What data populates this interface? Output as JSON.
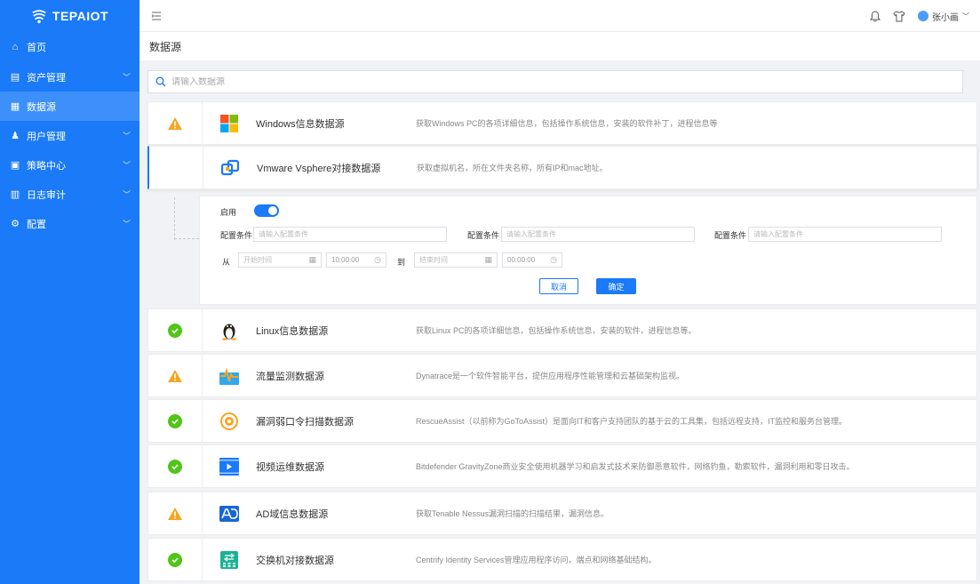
{
  "brand": {
    "name": "TEPAIOT"
  },
  "sidebar": {
    "items": [
      {
        "label": "首页",
        "icon": "home-icon",
        "has_children": false,
        "active": false
      },
      {
        "label": "资产管理",
        "icon": "asset-icon",
        "has_children": true,
        "active": false
      },
      {
        "label": "数据源",
        "icon": "datasource-icon",
        "has_children": false,
        "active": true
      },
      {
        "label": "用户管理",
        "icon": "users-icon",
        "has_children": true,
        "active": false
      },
      {
        "label": "策略中心",
        "icon": "policy-icon",
        "has_children": true,
        "active": false
      },
      {
        "label": "日志审计",
        "icon": "log-icon",
        "has_children": true,
        "active": false
      },
      {
        "label": "配置",
        "icon": "settings-icon",
        "has_children": true,
        "active": false
      }
    ]
  },
  "header": {
    "username": "张小画"
  },
  "page": {
    "title": "数据源"
  },
  "search": {
    "placeholder": "请输入数据源"
  },
  "sources": [
    {
      "name": "Windows信息数据源",
      "status": "warning",
      "logo": "windows-logo-icon",
      "desc": "获取Windows PC的各项详细信息，包括操作系统信息，安装的软件补丁，进程信息等"
    },
    {
      "name": "Vmware Vsphere对接数据源",
      "status": "none",
      "logo": "vmware-logo-icon",
      "desc": "获取虚拟机名，所在文件夹名称，所有IP和mac地址。"
    },
    {
      "name": "Linux信息数据源",
      "status": "ok",
      "logo": "linux-logo-icon",
      "desc": "获取Linux PC的各项详细信息，包括操作系统信息，安装的软件，进程信息等。"
    },
    {
      "name": "流量监测数据源",
      "status": "warning",
      "logo": "traffic-logo-icon",
      "desc": "Dynatrace是一个软件智能平台，提供应用程序性能管理和云基础架构监视。"
    },
    {
      "name": "漏洞弱口令扫描数据源",
      "status": "ok",
      "logo": "vuln-scan-logo-icon",
      "desc": "RescueAssist（以前称为GoToAssist）是面向IT和客户支持团队的基于云的工具集，包括远程支持，IT监控和服务台管理。"
    },
    {
      "name": "视频运维数据源",
      "status": "ok",
      "logo": "video-logo-icon",
      "desc": "Bitdefender GravityZone商业安全使用机器学习和启发式技术来防御恶意软件，网络钓鱼，勒索软件，漏洞利用和零日攻击。"
    },
    {
      "name": "AD域信息数据源",
      "status": "warning",
      "logo": "ad-logo-icon",
      "desc": "获取Tenable Nessus漏洞扫描的扫描结果，漏洞信息。"
    },
    {
      "name": "交换机对接数据源",
      "status": "ok",
      "logo": "switch-logo-icon",
      "desc": "Centrify Identity Services管理应用程序访问，端点和网络基础结构。"
    }
  ],
  "config": {
    "enable_label": "启用",
    "enabled": true,
    "condition_label": "配置条件",
    "condition_placeholder": "请输入配置条件",
    "from_label": "从",
    "to_label": "到",
    "start_date_placeholder": "开始时间",
    "start_time": "10:00:00",
    "end_date_placeholder": "结束时间",
    "end_time": "00:00:00",
    "cancel_label": "取消",
    "ok_label": "确定"
  },
  "colors": {
    "primary": "#1a7af8",
    "success": "#52c41a",
    "warning": "#f5a623"
  }
}
